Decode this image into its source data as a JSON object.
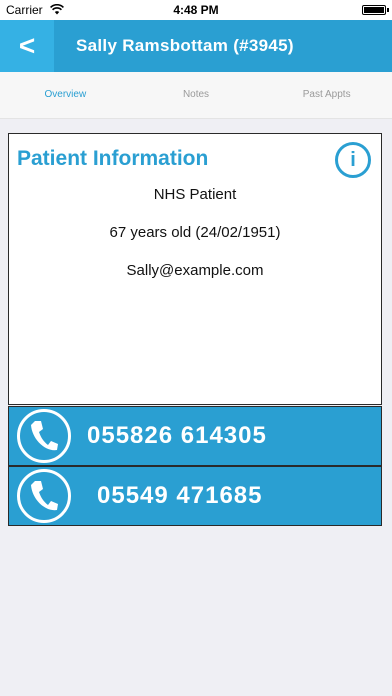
{
  "status_bar": {
    "carrier": "Carrier",
    "time": "4:48 PM"
  },
  "nav": {
    "back_label": "<",
    "title": "Sally Ramsbottam (#3945)"
  },
  "tabs": [
    {
      "label": "Overview",
      "active": true
    },
    {
      "label": "Notes",
      "active": false
    },
    {
      "label": "Past Appts",
      "active": false
    }
  ],
  "patient_info": {
    "heading": "Patient Information",
    "info_icon_label": "i",
    "lines": [
      "NHS Patient",
      "67 years old (24/02/1951)",
      "Sally@example.com"
    ]
  },
  "phones": [
    {
      "number": "055826 614305"
    },
    {
      "number": "05549 471685"
    }
  ],
  "colors": {
    "accent": "#2a9fd2",
    "accent_light": "#35b1e4",
    "background": "#efeff4"
  },
  "icons": {
    "wifi": "wifi-icon",
    "battery": "battery-icon",
    "info": "info-icon",
    "phone": "phone-icon"
  }
}
